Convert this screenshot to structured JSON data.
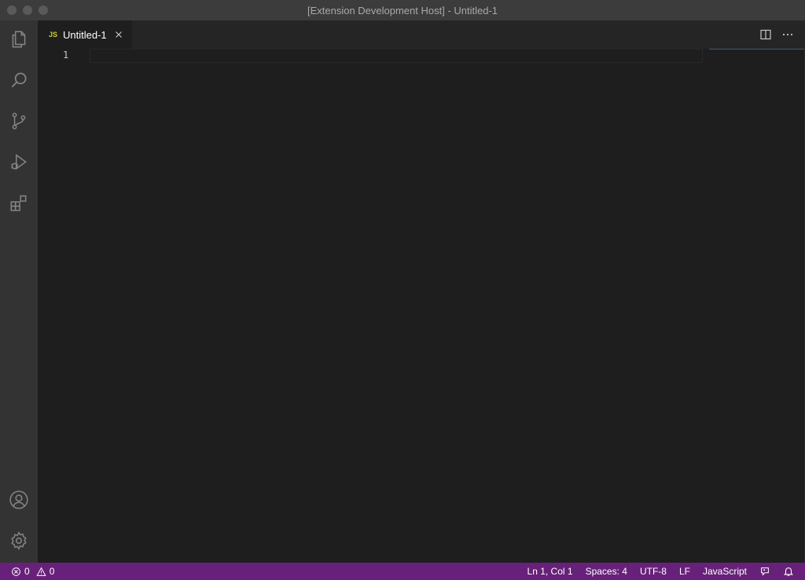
{
  "window": {
    "title": "[Extension Development Host] - Untitled-1"
  },
  "activity_bar": {
    "items": [
      {
        "name": "Explorer",
        "icon": "files-icon"
      },
      {
        "name": "Search",
        "icon": "search-icon"
      },
      {
        "name": "Source Control",
        "icon": "source-control-icon"
      },
      {
        "name": "Run and Debug",
        "icon": "run-debug-icon"
      },
      {
        "name": "Extensions",
        "icon": "extensions-icon"
      }
    ],
    "bottom": [
      {
        "name": "Accounts",
        "icon": "account-icon"
      },
      {
        "name": "Manage",
        "icon": "gear-icon"
      }
    ]
  },
  "editor": {
    "tab": {
      "lang_badge": "JS",
      "label": "Untitled-1"
    },
    "line_numbers": [
      "1"
    ]
  },
  "status_bar": {
    "errors": "0",
    "warnings": "0",
    "position": "Ln 1, Col 1",
    "indent": "Spaces: 4",
    "encoding": "UTF-8",
    "eol": "LF",
    "language": "JavaScript",
    "background_color": "#68217a"
  }
}
